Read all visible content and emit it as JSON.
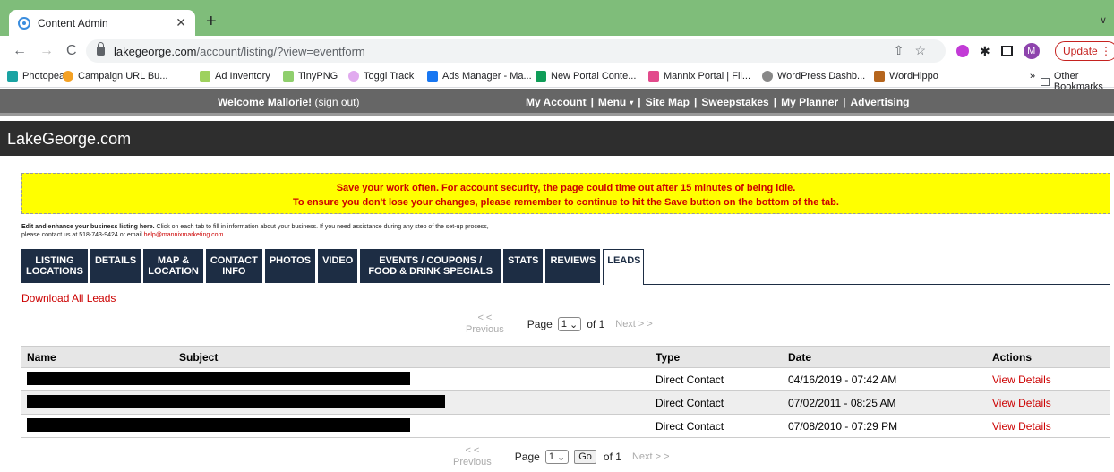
{
  "browser": {
    "tab_title": "Content Admin",
    "new_tab": "+",
    "tab_menu": "∨",
    "url_domain": "lakegeorge.com",
    "url_path": "/account/listing/?view=eventform",
    "avatar_letter": "M",
    "update_label": "Update",
    "bookmarks": [
      {
        "label": "Photopea",
        "color": "#1aa3a3"
      },
      {
        "label": "Campaign URL Bu...",
        "color": "#f4a124"
      },
      {
        "label": "Ad Inventory",
        "color": "#9ed15e"
      },
      {
        "label": "TinyPNG",
        "color": "#8fcf6d"
      },
      {
        "label": "Toggl Track",
        "color": "#e1aaef"
      },
      {
        "label": "Ads Manager - Ma...",
        "color": "#1877f2"
      },
      {
        "label": "New Portal Conte...",
        "color": "#0f9d58"
      },
      {
        "label": "Mannix Portal | Fli...",
        "color": "#e24b8c"
      },
      {
        "label": "WordPress Dashb...",
        "color": "#888888"
      },
      {
        "label": "WordHippo",
        "color": "#b5651d"
      }
    ],
    "bookmarks_more": "»",
    "other_bookmarks": "Other Bookmarks"
  },
  "site": {
    "welcome": "Welcome Mallorie!",
    "sign_out": "(sign out)",
    "links": {
      "my_account": "My Account",
      "menu": "Menu",
      "site_map": "Site Map",
      "sweepstakes": "Sweepstakes",
      "my_planner": "My Planner",
      "advertising": "Advertising"
    },
    "brand": "LakeGeorge.com"
  },
  "alert": {
    "line1": "Save your work often. For account security, the page could time out after 15 minutes of being idle.",
    "line2": "To ensure you don't lose your changes, please remember to continue to hit the Save button on the bottom of the tab."
  },
  "intro": {
    "bold": "Edit and enhance your business listing here.",
    "text": " Click on each tab to fill in information about your business. If you need assistance during any step of the set-up process,",
    "line2": "please contact us at 518-743-9424 or email ",
    "email": "help@mannixmarketing.com",
    "end": "."
  },
  "tabs": [
    {
      "l1": "LISTING",
      "l2": "LOCATIONS"
    },
    {
      "l1": "DETAILS",
      "l2": ""
    },
    {
      "l1": "MAP &",
      "l2": "LOCATION"
    },
    {
      "l1": "CONTACT",
      "l2": "INFO"
    },
    {
      "l1": "PHOTOS",
      "l2": ""
    },
    {
      "l1": "VIDEO",
      "l2": ""
    },
    {
      "l1": "EVENTS / COUPONS /",
      "l2": "FOOD & DRINK SPECIALS"
    },
    {
      "l1": "STATS",
      "l2": ""
    },
    {
      "l1": "REVIEWS",
      "l2": ""
    },
    {
      "l1": "LEADS",
      "l2": ""
    }
  ],
  "download_label": "Download All Leads",
  "pager": {
    "prev_arrows": "< <",
    "prev": "Previous",
    "page": "Page",
    "current": "1",
    "of": "of 1",
    "next": "Next > >",
    "go": "Go"
  },
  "table": {
    "headers": [
      "Name",
      "Subject",
      "Type",
      "Date",
      "Actions"
    ],
    "rows": [
      {
        "type": "Direct Contact",
        "date": "04/16/2019 - 07:42 AM",
        "action": "View Details"
      },
      {
        "type": "Direct Contact",
        "date": "07/02/2011 - 08:25 AM",
        "action": "View Details"
      },
      {
        "type": "Direct Contact",
        "date": "07/08/2010 - 07:29 PM",
        "action": "View Details"
      }
    ]
  }
}
